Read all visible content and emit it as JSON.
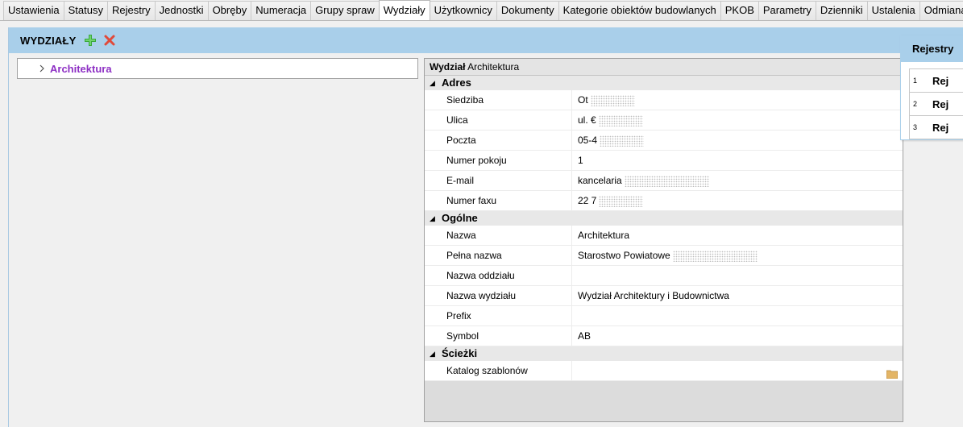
{
  "tabs": [
    {
      "label": "Ustawienia",
      "active": false
    },
    {
      "label": "Statusy",
      "active": false
    },
    {
      "label": "Rejestry",
      "active": false
    },
    {
      "label": "Jednostki",
      "active": false
    },
    {
      "label": "Obręby",
      "active": false
    },
    {
      "label": "Numeracja",
      "active": false
    },
    {
      "label": "Grupy spraw",
      "active": false
    },
    {
      "label": "Wydziały",
      "active": true
    },
    {
      "label": "Użytkownicy",
      "active": false
    },
    {
      "label": "Dokumenty",
      "active": false
    },
    {
      "label": "Kategorie obiektów budowlanych",
      "active": false
    },
    {
      "label": "PKOB",
      "active": false
    },
    {
      "label": "Parametry",
      "active": false
    },
    {
      "label": "Dzienniki",
      "active": false
    },
    {
      "label": "Ustalenia",
      "active": false
    },
    {
      "label": "Odmiana",
      "active": false
    }
  ],
  "panel": {
    "title": "WYDZIAŁY",
    "add_icon": "plus-icon",
    "delete_icon": "x-icon",
    "accent_color": "#a9cfea"
  },
  "tree": {
    "item_label": "Architektura",
    "item_color": "#8d2fc4"
  },
  "properties": {
    "header_label": "Wydział",
    "header_value": "Architektura",
    "categories": [
      {
        "label": "Adres",
        "rows": [
          {
            "name": "Siedziba",
            "value": "Ot",
            "masked": true
          },
          {
            "name": "Ulica",
            "value": "ul. €",
            "masked": true
          },
          {
            "name": "Poczta",
            "value": "05-4",
            "masked": true
          },
          {
            "name": "Numer pokoju",
            "value": "1",
            "masked": false
          },
          {
            "name": "E-mail",
            "value": "kancelaria",
            "masked": true
          },
          {
            "name": "Numer faxu",
            "value": "22 7",
            "masked": true
          }
        ]
      },
      {
        "label": "Ogólne",
        "rows": [
          {
            "name": "Nazwa",
            "value": "Architektura",
            "masked": false
          },
          {
            "name": "Pełna nazwa",
            "value": "Starostwo Powiatowe",
            "masked": true
          },
          {
            "name": "Nazwa oddziału",
            "value": "",
            "masked": false
          },
          {
            "name": "Nazwa wydziału",
            "value": "Wydział Architektury i Budownictwa",
            "masked": false
          },
          {
            "name": "Prefix",
            "value": "",
            "masked": false
          },
          {
            "name": "Symbol",
            "value": "AB",
            "masked": false
          }
        ]
      },
      {
        "label": "Ścieżki",
        "rows": [
          {
            "name": "Katalog szablonów",
            "value": "",
            "masked": false,
            "icon": "folder-icon"
          }
        ]
      }
    ]
  },
  "rejestry": {
    "title": "Rejestry",
    "items": [
      {
        "num": "1",
        "text": "Rej"
      },
      {
        "num": "2",
        "text": "Rej"
      },
      {
        "num": "3",
        "text": "Rej"
      }
    ]
  }
}
